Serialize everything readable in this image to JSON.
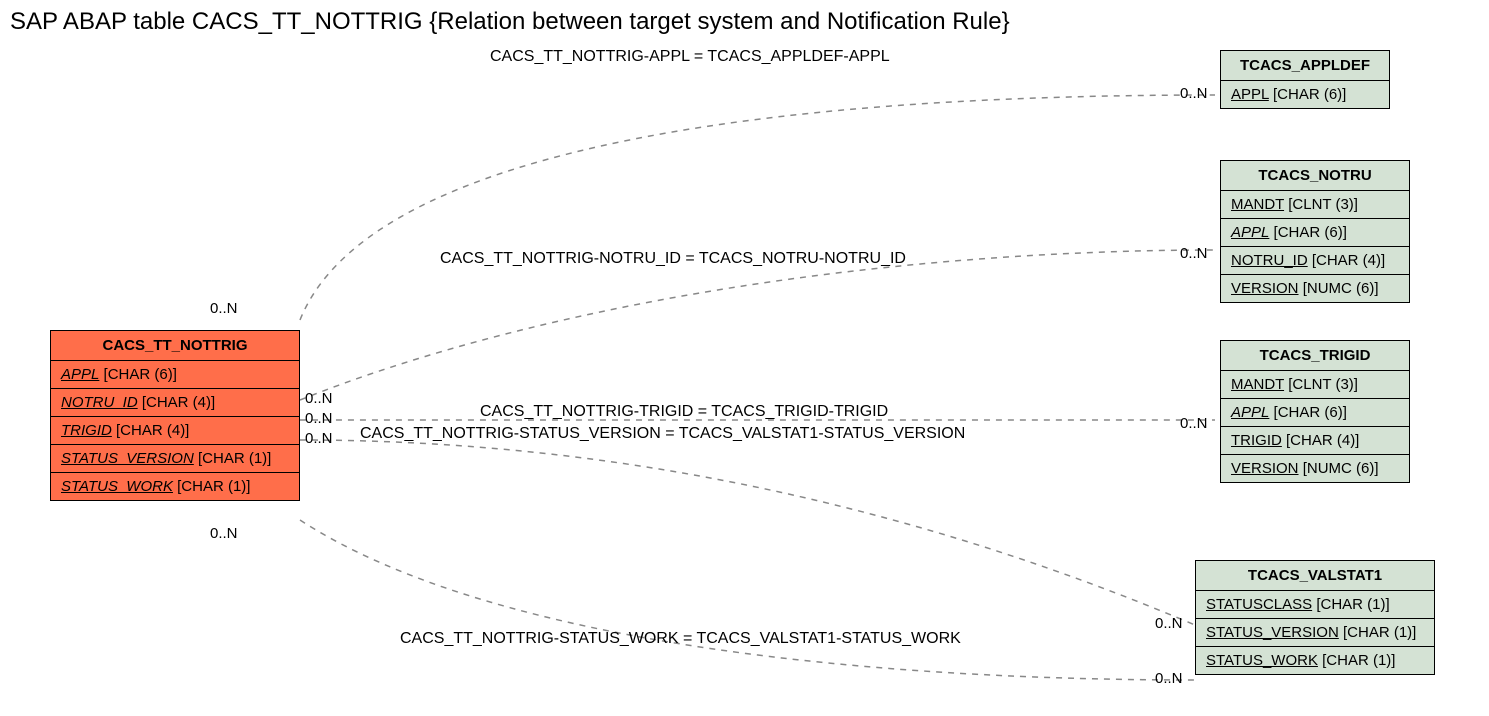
{
  "title": "SAP ABAP table CACS_TT_NOTTRIG {Relation between target system and Notification Rule}",
  "main_entity": {
    "name": "CACS_TT_NOTTRIG",
    "fields": [
      {
        "name": "APPL",
        "type": "[CHAR (6)]",
        "italic": true
      },
      {
        "name": "NOTRU_ID",
        "type": "[CHAR (4)]",
        "italic": true
      },
      {
        "name": "TRIGID",
        "type": "[CHAR (4)]",
        "italic": true
      },
      {
        "name": "STATUS_VERSION",
        "type": "[CHAR (1)]",
        "italic": true
      },
      {
        "name": "STATUS_WORK",
        "type": "[CHAR (1)]",
        "italic": true
      }
    ]
  },
  "targets": [
    {
      "name": "TCACS_APPLDEF",
      "fields": [
        {
          "name": "APPL",
          "type": "[CHAR (6)]",
          "italic": false
        }
      ]
    },
    {
      "name": "TCACS_NOTRU",
      "fields": [
        {
          "name": "MANDT",
          "type": "[CLNT (3)]",
          "italic": false
        },
        {
          "name": "APPL",
          "type": "[CHAR (6)]",
          "italic": true
        },
        {
          "name": "NOTRU_ID",
          "type": "[CHAR (4)]",
          "italic": false
        },
        {
          "name": "VERSION",
          "type": "[NUMC (6)]",
          "italic": false
        }
      ]
    },
    {
      "name": "TCACS_TRIGID",
      "fields": [
        {
          "name": "MANDT",
          "type": "[CLNT (3)]",
          "italic": false
        },
        {
          "name": "APPL",
          "type": "[CHAR (6)]",
          "italic": true
        },
        {
          "name": "TRIGID",
          "type": "[CHAR (4)]",
          "italic": false
        },
        {
          "name": "VERSION",
          "type": "[NUMC (6)]",
          "italic": false
        }
      ]
    },
    {
      "name": "TCACS_VALSTAT1",
      "fields": [
        {
          "name": "STATUSCLASS",
          "type": "[CHAR (1)]",
          "italic": false
        },
        {
          "name": "STATUS_VERSION",
          "type": "[CHAR (1)]",
          "italic": false
        },
        {
          "name": "STATUS_WORK",
          "type": "[CHAR (1)]",
          "italic": false
        }
      ]
    }
  ],
  "relations": [
    {
      "label": "CACS_TT_NOTTRIG-APPL = TCACS_APPLDEF-APPL"
    },
    {
      "label": "CACS_TT_NOTTRIG-NOTRU_ID = TCACS_NOTRU-NOTRU_ID"
    },
    {
      "label": "CACS_TT_NOTTRIG-TRIGID = TCACS_TRIGID-TRIGID"
    },
    {
      "label": "CACS_TT_NOTTRIG-STATUS_VERSION = TCACS_VALSTAT1-STATUS_VERSION"
    },
    {
      "label": "CACS_TT_NOTTRIG-STATUS_WORK = TCACS_VALSTAT1-STATUS_WORK"
    }
  ],
  "card": "0..N"
}
